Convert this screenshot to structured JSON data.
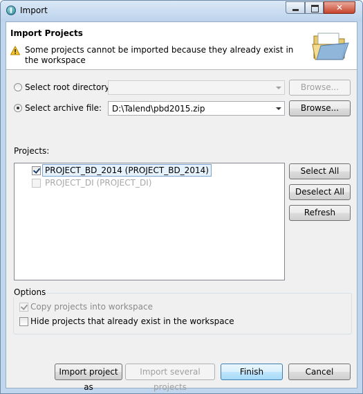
{
  "window": {
    "title": "Import",
    "close_glyph": "✕"
  },
  "header": {
    "title": "Import Projects",
    "message": "Some projects cannot be imported because they already exist in the workspace"
  },
  "source": {
    "root_directory_label": "Select root directory:",
    "root_directory_value": "",
    "archive_file_label": "Select archive file:",
    "archive_file_value": "D:\\Talend\\pbd2015.zip",
    "browse_label": "Browse..."
  },
  "projects": {
    "label": "Projects:",
    "items": [
      {
        "label": "PROJECT_BD_2014 (PROJECT_BD_2014)",
        "checked": true
      },
      {
        "label": "PROJECT_DI (PROJECT_DI)",
        "checked": false
      }
    ],
    "select_all": "Select All",
    "deselect_all": "Deselect All",
    "refresh": "Refresh"
  },
  "options": {
    "legend": "Options",
    "copy_label": "Copy projects into workspace",
    "hide_label": "Hide projects that already exist in the workspace"
  },
  "footer": {
    "import_as": "Import project as",
    "import_several": "Import several projects",
    "finish": "Finish",
    "cancel": "Cancel"
  },
  "icons": {
    "app": "talend-icon",
    "warning": "warning-icon",
    "folder": "open-folder-icon"
  }
}
